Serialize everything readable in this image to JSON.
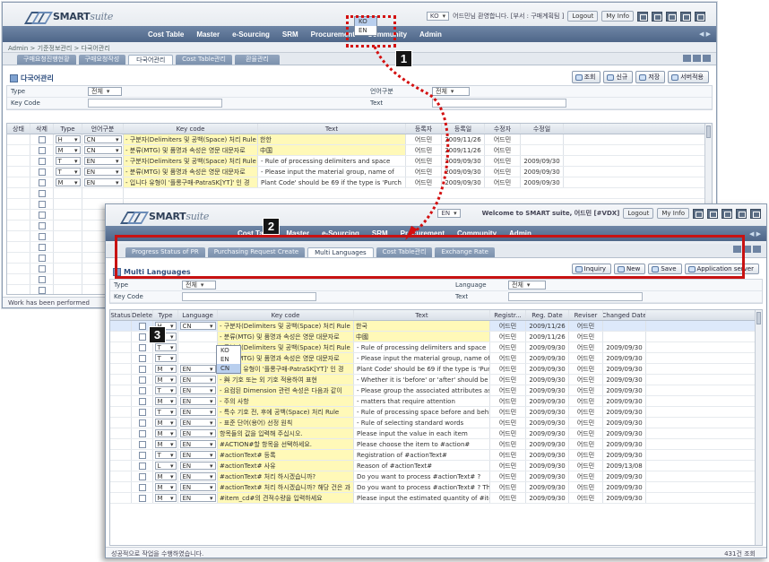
{
  "back": {
    "logo": "SMART",
    "logo_suffix": "suite",
    "welcome": "어드민님 환영합니다. [부서 : 구매계획팀 ]",
    "lang_selected": "KO",
    "logout": "Logout",
    "myinfo": "My Info",
    "menu": [
      "Cost Table",
      "Master",
      "e-Sourcing",
      "SRM",
      "Procurement",
      "Community",
      "Admin"
    ],
    "breadcrumb": "Admin > 기준정보관리 > 다국어관리",
    "tabs": [
      "구매요청진행현황",
      "구매요청작성",
      "다국어관리",
      "Cost Table관리",
      "환율관리"
    ],
    "active_tab": 2,
    "page_title": "다국어관리",
    "actions": [
      "조회",
      "신규",
      "저장",
      "서버적용"
    ],
    "filter": {
      "type_label": "Type",
      "type_value": "전체",
      "keycode_label": "Key Code",
      "lang_label": "언어구분",
      "lang_value": "전체",
      "text_label": "Text"
    },
    "columns": [
      "상태",
      "삭제",
      "Type",
      "언어구분",
      "Key code",
      "Text",
      "등록자",
      "등록일",
      "수정자",
      "수정일"
    ],
    "rows": [
      [
        "",
        "H",
        "CN",
        "- 구분자(Delimiters 및 공백(Space) 처리 Rule",
        "&#54620;&#54620;",
        "어드민",
        "2009/11/26",
        "어드민",
        ""
      ],
      [
        "",
        "M",
        "CN",
        "- 분류(MTG) 및 품명과 속성은 영문 대문자로",
        "&#20013;&#22269;",
        "어드민",
        "2009/11/26",
        "어드민",
        ""
      ],
      [
        "",
        "T",
        "EN",
        "- 구분자(Delimiters 및 공백(Space) 처리 Rule",
        "- Rule of processing delimiters and space",
        "어드민",
        "2009/09/30",
        "어드민",
        "2009/09/30"
      ],
      [
        "",
        "T",
        "EN",
        "- 분류(MTG) 및 품명과 속성은 영문 대문자로",
        "- Please input the material group, name of",
        "어드민",
        "2009/09/30",
        "어드민",
        "2009/09/30"
      ],
      [
        "",
        "M",
        "EN",
        "- 입니다 유형이 '플롱구매-PatraSK[YT]' 인 경",
        "Plant Code' should be 69 if the type is 'Purch",
        "어드민",
        "2009/09/30",
        "어드민",
        "2009/09/30"
      ]
    ],
    "status": "Work has been performed"
  },
  "popup_back": [
    "KO",
    "EN"
  ],
  "front": {
    "logo": "SMART",
    "logo_suffix": "suite",
    "lang_selected": "EN",
    "welcome": "Welcome to SMART suite, 어드민 [#VDX]",
    "logout": "Logout",
    "myinfo": "My Info",
    "menu": [
      "Cost Table",
      "Master",
      "e-Sourcing",
      "SRM",
      "Procurement",
      "Community",
      "Admin"
    ],
    "tabs": [
      "Progress Status of PR",
      "Purchasing Request Create",
      "Multi Languages",
      "Cost Table관리",
      "Exchange Rate"
    ],
    "active_tab": 2,
    "page_title": "Multi Languages",
    "actions": [
      "Inquiry",
      "New",
      "Save",
      "Application server"
    ],
    "filter": {
      "type_label": "Type",
      "type_value": "전체",
      "keycode_label": "Key Code",
      "lang_label": "Language",
      "lang_value": "전체",
      "text_label": "Text"
    },
    "columns": [
      "Status",
      "Delete",
      "Type",
      "Language",
      "Key code",
      "Text",
      "Registr...",
      "Reg. Date",
      "Reviser",
      "Changed Date"
    ],
    "rows": [
      [
        "",
        "H",
        "CN",
        "- 구분자(Delimiters 및 공백(Space) 처리 Rule",
        "한국",
        "어드민",
        "2009/11/26",
        "어드민",
        ""
      ],
      [
        "",
        "M",
        "",
        "- 분류(MTG) 및 품명과 속성은 영문 대문자로",
        "中國",
        "어드민",
        "2009/11/26",
        "어드민",
        ""
      ],
      [
        "",
        "T",
        "",
        "- 구분자(Delimiters 및 공백(Space) 처리 Rule",
        "- Rule of processing delimiters and space",
        "어드민",
        "2009/09/30",
        "어드민",
        "2009/09/30"
      ],
      [
        "",
        "T",
        "",
        "- 분류(MTG) 및 품명과 속성은 영문 대문자로",
        "- Please input the material group, name of st",
        "어드민",
        "2009/09/30",
        "어드민",
        "2009/09/30"
      ],
      [
        "",
        "M",
        "EN",
        "- 입니다 유형이 '플롱구매-PatraSK[YT]' 인 경",
        "Plant Code' should be 69 if the type is 'Purch",
        "어드민",
        "2009/09/30",
        "어드민",
        "2009/09/30"
      ],
      [
        "",
        "M",
        "EN",
        "- 與 기호 또는 외 기호 적용하여 표현",
        "- Whether it is 'before' or 'after' should be se",
        "어드민",
        "2009/09/30",
        "어드민",
        "2009/09/30"
      ],
      [
        "",
        "T",
        "EN",
        "- 요컴된 Dimension 관련 속성은 다음과 같이",
        "- Please group the associated attributes as f",
        "어드민",
        "2009/09/30",
        "어드민",
        "2009/09/30"
      ],
      [
        "",
        "M",
        "EN",
        "- 주의 사항",
        "- matters that require attention",
        "어드민",
        "2009/09/30",
        "어드민",
        "2009/09/30"
      ],
      [
        "",
        "T",
        "EN",
        "- 특수 기호 전, 후에 공백(Space) 처리 Rule",
        "- Rule of processing space before and behir",
        "어드민",
        "2009/09/30",
        "어드민",
        "2009/09/30"
      ],
      [
        "",
        "M",
        "EN",
        "- 표준 단어(용어) 선정 원칙",
        "- Rule of selecting standard words",
        "어드민",
        "2009/09/30",
        "어드민",
        "2009/09/30"
      ],
      [
        "",
        "M",
        "EN",
        "항목들의 값을 입력해 주십시오.",
        "Please input the value in each item",
        "어드민",
        "2009/09/30",
        "어드민",
        "2009/09/30"
      ],
      [
        "",
        "M",
        "EN",
        "#ACTION#할 항목을 선택하세요.",
        "Please choose the item to #action#",
        "어드민",
        "2009/09/30",
        "어드민",
        "2009/09/30"
      ],
      [
        "",
        "T",
        "EN",
        "#actionText# 등록",
        "Registration of #actionText#",
        "어드민",
        "2009/09/30",
        "어드민",
        "2009/09/30"
      ],
      [
        "",
        "L",
        "EN",
        "#actionText# 사유",
        "Reason of #actionText#",
        "어드민",
        "2009/09/30",
        "어드민",
        "2009/13/08"
      ],
      [
        "",
        "M",
        "EN",
        "#actionText# 처리 하시겠습니까?",
        "Do you want to process #actionText# ?",
        "어드민",
        "2009/09/30",
        "어드민",
        "2009/09/30"
      ],
      [
        "",
        "M",
        "EN",
        "#actionText# 처리 하시겠습니까? 해당 건은 과",
        "Do you want to process #actionText# ? This",
        "어드민",
        "2009/09/30",
        "어드민",
        "2009/09/30"
      ],
      [
        "",
        "M",
        "EN",
        "#item_cd#의 견적수량을 입력하세요",
        "Please input the estimated quantity of #item_c",
        "어드민",
        "2009/09/30",
        "어드민",
        "2009/09/30"
      ]
    ],
    "status": "성공적으로 작업을 수행하였습니다.",
    "count": "431건 조회"
  },
  "popup_front": [
    "KO",
    "EN",
    "CN"
  ],
  "callouts": [
    "1",
    "2",
    "3"
  ]
}
